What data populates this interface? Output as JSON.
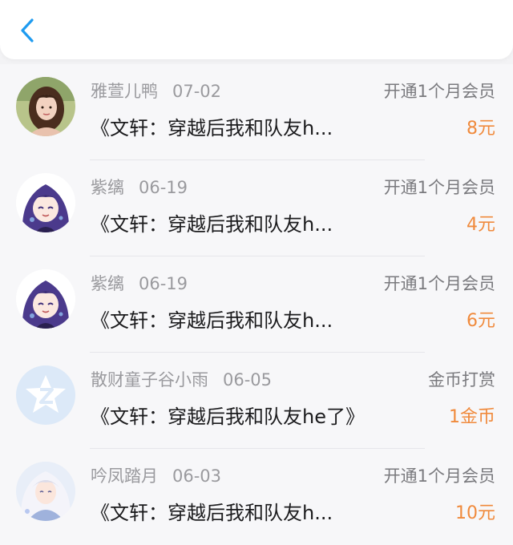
{
  "header": {
    "back_icon": "chevron-left-icon",
    "accent_color": "#1e9bf0"
  },
  "records": [
    {
      "user": "雅萱儿鸭",
      "date": "07-02",
      "action": "开通1个月会员",
      "book": "《文轩：穿越后我和队友h...",
      "amount": "8元",
      "avatar": "photo-avatar-girl"
    },
    {
      "user": "紫缡",
      "date": "06-19",
      "action": "开通1个月会员",
      "book": "《文轩：穿越后我和队友h...",
      "amount": "4元",
      "avatar": "anime-avatar-purple-hair"
    },
    {
      "user": "紫缡",
      "date": "06-19",
      "action": "开通1个月会员",
      "book": "《文轩：穿越后我和队友h...",
      "amount": "6元",
      "avatar": "anime-avatar-purple-hair"
    },
    {
      "user": "散财童子谷小雨",
      "date": "06-05",
      "action": "金币打赏",
      "book": "《文轩：穿越后我和队友he了》",
      "amount": "1金币",
      "avatar": "default-qq-avatar"
    },
    {
      "user": "吟凤踏月",
      "date": "06-03",
      "action": "开通1个月会员",
      "book": "《文轩：穿越后我和队友h...",
      "amount": "10元",
      "avatar": "anime-avatar-white-hair"
    }
  ],
  "colors": {
    "amount": "#f08a3c",
    "meta": "#9a9a9e",
    "title": "#1b1b1d"
  }
}
